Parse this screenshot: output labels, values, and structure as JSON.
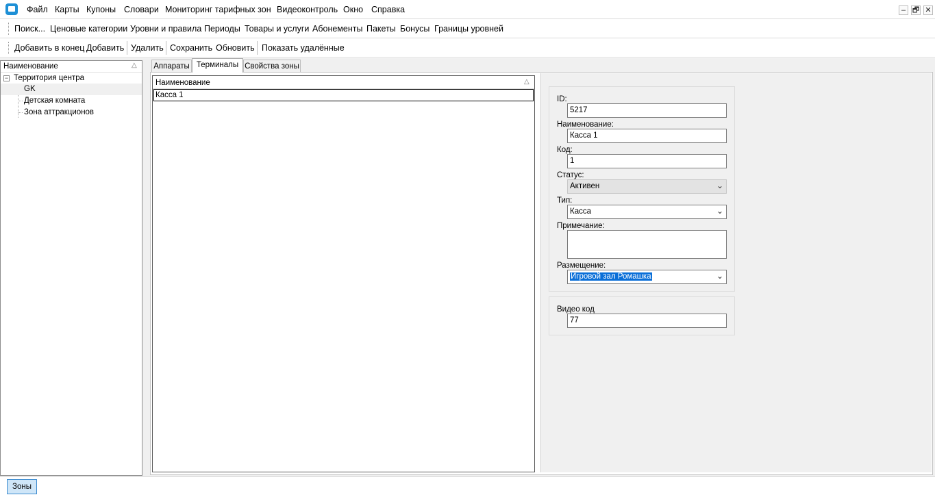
{
  "menu": {
    "items": [
      "Файл",
      "Карты",
      "Купоны",
      "Словари",
      "Мониторинг тарифных зон",
      "Видеоконтроль",
      "Окно",
      "Справка"
    ]
  },
  "window_controls": {
    "minimize": "–",
    "restore": "🗗",
    "close": "✕"
  },
  "nav_toolbar": {
    "items": [
      "Поиск...",
      "Ценовые категории",
      "Уровни и правила",
      "Периоды",
      "Товары и услуги",
      "Абонементы",
      "Пакеты",
      "Бонусы",
      "Границы уровней"
    ]
  },
  "action_toolbar": {
    "add_end": "Добавить в конец",
    "add": "Добавить",
    "delete": "Удалить",
    "save": "Сохранить",
    "refresh": "Обновить",
    "show_deleted": "Показать удалённые"
  },
  "tree": {
    "header": "Наименование",
    "sort_glyph": "△",
    "root": "Территория центра",
    "children": [
      "GK",
      "Детская комната",
      "Зона аттракционов"
    ]
  },
  "tabs": [
    "Аппараты",
    "Терминалы",
    "Свойства зоны"
  ],
  "grid": {
    "header": "Наименование",
    "rows": [
      "Касса 1"
    ]
  },
  "form": {
    "id_label": "ID:",
    "id_value": "5217",
    "name_label": "Наименование:",
    "name_value": "Касса 1",
    "code_label": "Код:",
    "code_value": "1",
    "status_label": "Статус:",
    "status_value": "Активен",
    "type_label": "Тип:",
    "type_value": "Касса",
    "note_label": "Примечание:",
    "note_value": "",
    "placement_label": "Размещение:",
    "placement_value": "Игровой зал Ромашка",
    "video_label": "Видео код",
    "video_value": "77"
  },
  "taskbar": {
    "button": "Зоны"
  }
}
